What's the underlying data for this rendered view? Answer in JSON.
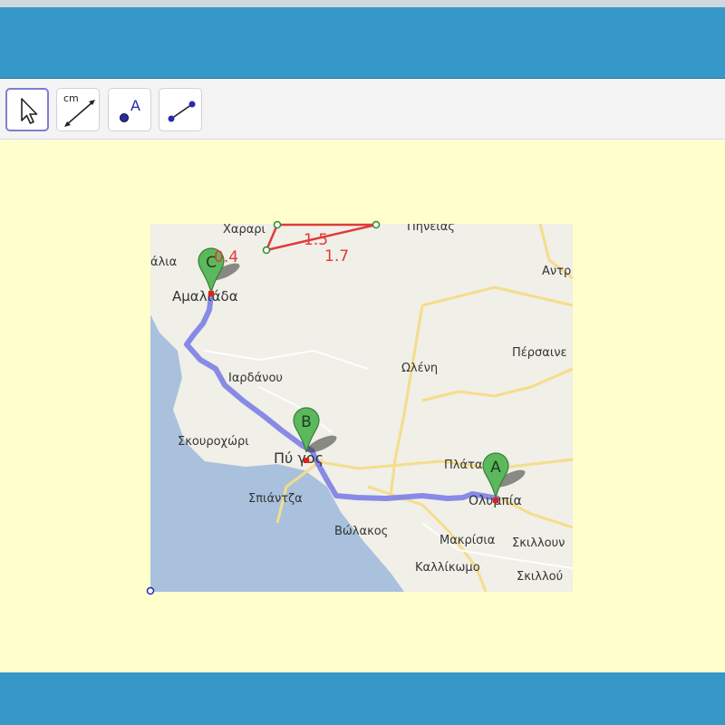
{
  "toolbar": {
    "tools": [
      {
        "name": "Move",
        "icon": "cursor-arrow-icon",
        "active": true
      },
      {
        "name": "Distance or Length",
        "icon": "distance-cm-icon",
        "text": "cm"
      },
      {
        "name": "Point",
        "icon": "point-icon",
        "text": "A"
      },
      {
        "name": "Segment",
        "icon": "segment-icon"
      }
    ]
  },
  "colors": {
    "header": "#3598c9",
    "canvas": "#ffffcc",
    "route": "#7b7ee6",
    "pin": "#4fae4f",
    "segment": "#e03a3a",
    "point": "#2222cc"
  },
  "map": {
    "places": {
      "amaliada": "Αμαλιάδα",
      "pyrgos": "Πύ γος",
      "olympia": "Ολυμπία",
      "iardanou": "Ιαρδάνου",
      "skourochori": "Σκουροχώρι",
      "spiantza": "Σπιάντζα",
      "volakos": "Βώλακος",
      "makrisia": "Μακρίσια",
      "kallikomo": "Καλλίκωμο",
      "skillountia1": "Σκιλλουν",
      "skillountia2": "Σκιλλού",
      "platanos": "Πλάτα",
      "perseine": "Πέρσαινε",
      "olena": "Ωλένη",
      "antr": "Αντρ",
      "alia": "άλια",
      "charari": "Χαραρι",
      "pineias": "Πηνειας"
    },
    "pins": [
      {
        "letter": "A"
      },
      {
        "letter": "B"
      },
      {
        "letter": "C"
      }
    ]
  },
  "construction": {
    "segment_labels": [
      "0.4",
      "1.5",
      "1.7"
    ]
  }
}
